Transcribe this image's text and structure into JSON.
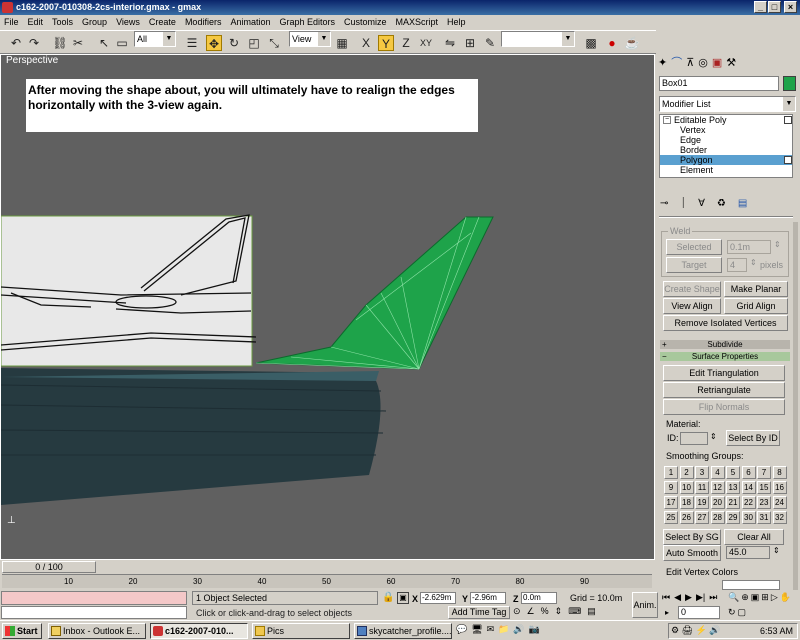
{
  "window": {
    "title": "c162-2007-010308-2cs-interior.gmax - gmax",
    "min": "_",
    "max": "□",
    "close": "×"
  },
  "menu": [
    "File",
    "Edit",
    "Tools",
    "Group",
    "Views",
    "Create",
    "Modifiers",
    "Animation",
    "Graph Editors",
    "Customize",
    "MAXScript",
    "Help"
  ],
  "toolbar": {
    "selection_filter": "All",
    "reference_coord": "View"
  },
  "viewport": {
    "label": "Perspective",
    "caption": "After moving the shape about, you will ultimately have to realign the edges horizontally with the 3-view again."
  },
  "panel": {
    "object_name": "Box01",
    "modifier_list": "Modifier List",
    "stack": [
      "Editable Poly",
      "Vertex",
      "Edge",
      "Border",
      "Polygon",
      "Element"
    ],
    "selected_stack": "Polygon",
    "weld": {
      "title": "Weld",
      "selected_label": "Selected",
      "selected_value": "0.1m",
      "target_label": "Target",
      "target_value": "4",
      "pixels": "pixels"
    },
    "create_shape": "Create Shape",
    "make_planar": "Make Planar",
    "view_align": "View Align",
    "grid_align": "Grid Align",
    "remove_isolated": "Remove Isolated Vertices",
    "subdivide": "Subdivide",
    "surface_properties": "Surface Properties",
    "edit_triangulation": "Edit Triangulation",
    "retriangulate": "Retriangulate",
    "flip_normals": "Flip Normals",
    "material": "Material:",
    "id_label": "ID:",
    "select_by_id": "Select By ID",
    "smoothing_groups": "Smoothing Groups:",
    "sg_numbers": [
      "1",
      "2",
      "3",
      "4",
      "5",
      "6",
      "7",
      "8",
      "9",
      "10",
      "11",
      "12",
      "13",
      "14",
      "15",
      "16",
      "17",
      "18",
      "19",
      "20",
      "21",
      "22",
      "23",
      "24",
      "25",
      "26",
      "27",
      "28",
      "29",
      "30",
      "31",
      "32"
    ],
    "select_by_sg": "Select By SG",
    "clear_all": "Clear All",
    "auto_smooth": "Auto Smooth",
    "auto_smooth_value": "45.0",
    "edit_vertex_colors": "Edit Vertex Colors"
  },
  "timeline": {
    "slider": "0 / 100",
    "ticks": [
      "10",
      "20",
      "30",
      "40",
      "50",
      "60",
      "70",
      "80",
      "90"
    ]
  },
  "status": {
    "selected": "1 Object Selected",
    "prompt": "Click or click-and-drag to select objects",
    "x_label": "X",
    "x_value": "-2.629m",
    "y_label": "Y",
    "y_value": "-2.96m",
    "z_label": "Z",
    "z_value": "0.0m",
    "grid": "Grid = 10.0m",
    "add_time_tag": "Add Time Tag",
    "anim": "Anim.",
    "frame": "0"
  },
  "taskbar": {
    "start": "Start",
    "tasks": [
      "Inbox - Outlook E...",
      "c162-2007-010...",
      "Pics",
      "skycatcher_profile...."
    ],
    "clock": "6:53 AM"
  },
  "colors": {
    "accent_green": "#1ea34a",
    "selection_blue": "#5aa0d0"
  }
}
